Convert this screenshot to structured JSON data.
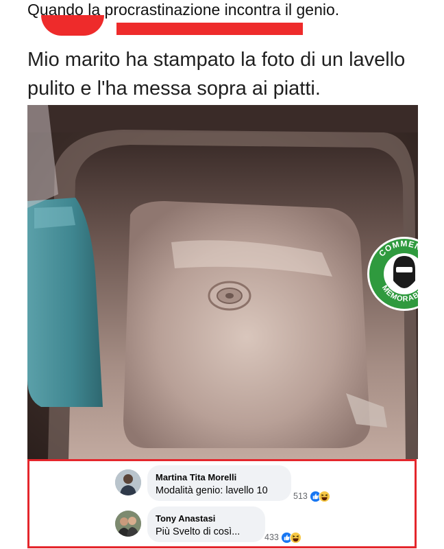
{
  "post": {
    "title": "Quando la procrastinazione incontra il genio."
  },
  "meme": {
    "caption": "Mio marito ha stampato la foto di un lavello pulito e l'ha messa sopra ai piatti.",
    "badge": {
      "top_text": "COMMENTI",
      "bottom_text": "MEMORABILI",
      "colors": {
        "ring": "#2f9a3e",
        "text": "#ffffff"
      }
    }
  },
  "comments": [
    {
      "author": "Martina Tita Morelli",
      "text": "Modalità genio: lavello 10",
      "reaction_count": "513",
      "reaction_icons": [
        "like-icon",
        "haha-icon"
      ]
    },
    {
      "author": "Tony Anastasi",
      "text": "Più Svelto di così...",
      "reaction_count": "433",
      "reaction_icons": [
        "like-icon",
        "haha-icon"
      ]
    }
  ],
  "colors": {
    "highlight_border": "#e4262c",
    "redaction": "#ee2b2b",
    "like_blue": "#1877f2",
    "haha_yellow": "#f7c846",
    "bubble_bg": "#f0f2f5"
  }
}
